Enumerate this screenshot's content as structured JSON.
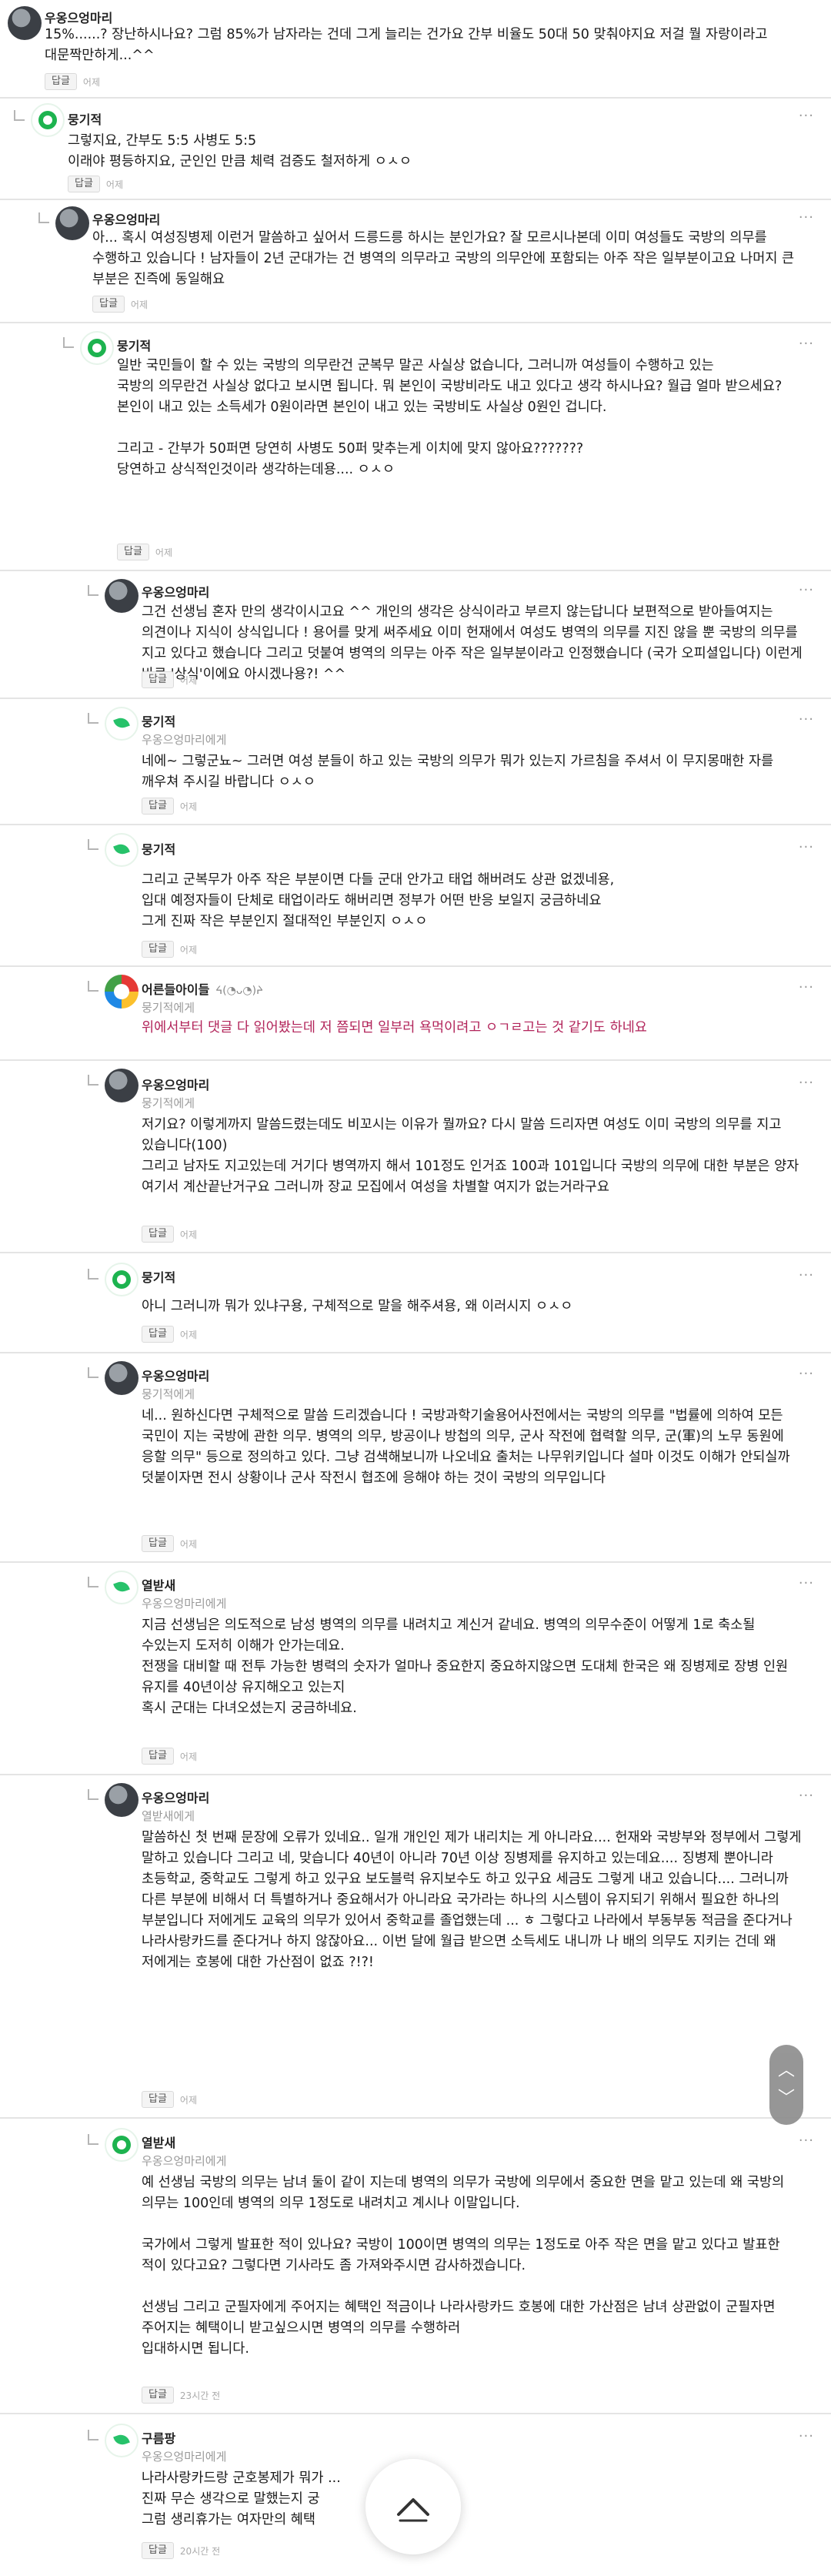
{
  "ui": {
    "reply_label": "답글",
    "more_icon": "more-dots-icon"
  },
  "comments": [
    {
      "id": "c1",
      "author": "우옹으엉마리",
      "mention": "",
      "time": "어제",
      "avatar": "photo",
      "text": "15%......? 장난하시나요? 그럼 85%가 남자라는 건데 그게 늘리는 건가요 간부 비율도 50대 50 맞춰야지요 저걸 뭘 자랑이라고 대문짝만하게...^^"
    },
    {
      "id": "c2",
      "author": "뭉기적",
      "mention": "",
      "time": "어제",
      "avatar": "green",
      "text": "그렇지요, 간부도 5:5 사병도 5:5\n이래야 평등하지요, 군인인 만큼 체력 검증도 철저하게 ㅇㅅㅇ"
    },
    {
      "id": "c3",
      "author": "우옹으엉마리",
      "mention": "",
      "time": "어제",
      "avatar": "photo",
      "text": "아... 혹시 여성징병제 이런거 말씀하고 싶어서 드릉드릉 하시는 분인가요? 잘 모르시나본데 이미 여성들도 국방의 의무를 수행하고 있습니다 ! 남자들이 2년 군대가는 건 병역의 의무라고 국방의 의무안에 포함되는 아주 작은 일부분이고요 나머지 큰 부분은 진즉에 동일해요"
    },
    {
      "id": "c4",
      "author": "뭉기적",
      "mention": "",
      "time": "어제",
      "avatar": "green",
      "text": "일반 국민들이 할 수 있는 국방의 의무란건 군복무 말곤 사실상 없습니다, 그러니까 여성들이 수행하고 있는\n국방의 의무란건 사실상 없다고 보시면 됩니다. 뭐 본인이 국방비라도 내고 있다고 생각 하시나요? 월급 얼마 받으세요? 본인이 내고 있는 소득세가 0원이라면 본인이 내고 있는 국방비도 사실상 0원인 겁니다.\n\n그리고 - 간부가 50퍼면 당연히 사병도 50퍼 맞추는게 이치에 맞지 않아요???????\n당연하고 상식적인것이라 생각하는데용.... ㅇㅅㅇ"
    },
    {
      "id": "c5",
      "author": "우옹으엉마리",
      "mention": "",
      "time": "어제",
      "avatar": "photo",
      "text": "그건 선생님 혼자 만의 생각이시고요 ^^ 개인의 생각은 상식이라고 부르지 않는답니다 보편적으로 받아들여지는 의견이나 지식이 상식입니다 ! 용어를 맞게 써주세요 이미 헌재에서 여성도 병역의 의무를 지진 않을 뿐 국방의 의무를 지고 있다고 했습니다 그리고 덧붙여 병역의 의무는 아주 작은 일부분이라고 인정했습니다 (국가 오피셜입니다) 이런게 바로 '상식'이에요 아시겠나용?! ^^"
    },
    {
      "id": "c6",
      "author": "뭉기적",
      "mention": "우옹으엉마리에게",
      "time": "어제",
      "avatar": "leaf",
      "text": "네에~ 그렇군뇨~ 그러면 여성 분들이 하고 있는 국방의 의무가 뭐가 있는지 가르침을 주셔서 이 무지몽매한 자를 깨우쳐 주시길 바랍니다 ㅇㅅㅇ"
    },
    {
      "id": "c7",
      "author": "뭉기적",
      "mention": "",
      "time": "어제",
      "avatar": "leaf",
      "text": "그리고 군복무가 아주 작은 부분이면 다들 군대 안가고 태업 해버려도 상관 없겠네용,\n입대 예정자들이 단체로 태업이라도 해버리면 정부가 어떤 반응 보일지 궁금하네요\n그게 진짜 작은 부분인지 절대적인 부분인지 ㅇㅅㅇ"
    },
    {
      "id": "c8",
      "author": "어른들아이들",
      "emoticon": "ᔦ(◔ᴗ◔)ᔨ",
      "mention": "뭉기적에게",
      "time": "",
      "avatar": "multi",
      "highlight": true,
      "text": "위에서부터 댓글 다 읽어봤는데 저 쯤되면 일부러 욕먹이려고 ㅇㄱㄹ고는 것 같기도 하네요"
    },
    {
      "id": "c9",
      "author": "우옹으엉마리",
      "mention": "뭉기적에게",
      "time": "어제",
      "avatar": "photo",
      "text": "저기요? 이렇게까지 말씀드렸는데도 비꼬시는 이유가 뭘까요? 다시 말씀 드리자면 여성도 이미 국방의 의무를 지고 있습니다(100)\n그리고 남자도 지고있는데 거기다 병역까지 해서 101정도 인거죠 100과 101입니다 국방의 의무에 대한 부분은 양자 여기서 계산끝난거구요 그러니까 장교 모집에서 여성을 차별할 여지가 없는거라구요"
    },
    {
      "id": "c10",
      "author": "뭉기적",
      "mention": "",
      "time": "어제",
      "avatar": "green",
      "text": "아니 그러니까 뭐가 있냐구용, 구체적으로 말을 해주셔용, 왜 이러시지 ㅇㅅㅇ"
    },
    {
      "id": "c11",
      "author": "우옹으엉마리",
      "mention": "뭉기적에게",
      "time": "어제",
      "avatar": "photo",
      "text": "네... 원하신다면 구체적으로 말씀 드리겠습니다 ! 국방과학기술용어사전에서는 국방의 의무를 \"법률에 의하여 모든 국민이 지는 국방에 관한 의무. 병역의 의무, 방공이나 방첩의 의무, 군사 작전에 협력할 의무, 군(軍)의 노무 동원에 응할 의무\" 등으로 정의하고 있다. 그냥 검색해보니까 나오네요 출처는 나무위키입니다 설마 이것도 이해가 안되실까 덧붙이자면 전시 상황이나 군사 작전시 협조에 응해야 하는 것이 국방의 의무입니다"
    },
    {
      "id": "c12",
      "author": "열받새",
      "mention": "우옹으엉마리에게",
      "time": "어제",
      "avatar": "leaf",
      "text": "지금 선생님은 의도적으로 남성 병역의 의무를 내려치고 계신거 같네요. 병역의 의무수준이 어떻게 1로 축소될 수있는지 도저히 이해가 안가는데요.\n전쟁을 대비할 때 전투 가능한 병력의 숫자가 얼마나 중요한지 중요하지않으면 도대체 한국은 왜 징병제로 장병 인원 유지를 40년이상 유지해오고 있는지\n혹시 군대는 다녀오셨는지 궁금하네요."
    },
    {
      "id": "c13",
      "author": "우옹으엉마리",
      "mention": "열받새에게",
      "time": "어제",
      "avatar": "photo",
      "text": "말씀하신 첫 번째 문장에 오류가 있네요.. 일개 개인인 제가 내리치는 게 아니라요.... 헌재와 국방부와 정부에서 그렇게 말하고 있습니다 그리고 네, 맞습니다 40년이 아니라 70년 이상 징병제를 유지하고 있는데요.... 징병제 뿐아니라 초등학교, 중학교도 그렇게 하고 있구요 보도블럭 유지보수도 하고 있구요 세금도 그렇게 내고 있습니다.... 그러니까 다른 부분에 비해서 더 특별하거나 중요해서가 아니라요 국가라는 하나의 시스템이 유지되기 위해서 필요한 하나의 부분입니다 저에게도 교육의 의무가 있어서 중학교를 졸업했는데 ... ㅎ 그렇다고 나라에서 부동부동 적금을 준다거나 나라사랑카드를 준다거나 하지 않잖아요... 이번 달에 월급 받으면 소득세도 내니까 나 배의 의무도 지키는 건데 왜 저에게는 호봉에 대한 가산점이 없죠 ?!?!"
    },
    {
      "id": "c14",
      "author": "열받새",
      "mention": "우옹으엉마리에게",
      "time": "23시간 전",
      "avatar": "green",
      "text": "예 선생님 국방의 의무는 남녀 둘이 같이 지는데 병역의 의무가 국방에 의무에서 중요한 면을 맡고 있는데 왜 국방의 의무는 100인데 병역의 의무 1정도로 내려치고 계시나 이말입니다.\n\n국가에서 그렇게 발표한 적이 있나요? 국방이 100이면 병역의 의무는 1정도로 아주 작은 면을 맡고 있다고 발표한 적이 있다고요? 그렇다면 기사라도 좀 가져와주시면 감사하겠습니다.\n\n선생님 그리고 군필자에게 주어지는 혜택인 적금이나 나라사랑카드 호봉에 대한 가산점은 남녀 상관없이 군필자면 주어지는 혜택이니 받고싶으시면 병역의 의무를 수행하러\n입대하시면 됩니다."
    },
    {
      "id": "c15",
      "author": "구름팡",
      "mention": "우옹으엉마리에게",
      "time": "20시간 전",
      "avatar": "leaf",
      "text": "나라사랑카드랑 군호봉제가 뭐가 ...\n진짜 무슨 생각으로 말했는지 궁\n그럼 생리휴가는 여자만의 혜택"
    }
  ]
}
